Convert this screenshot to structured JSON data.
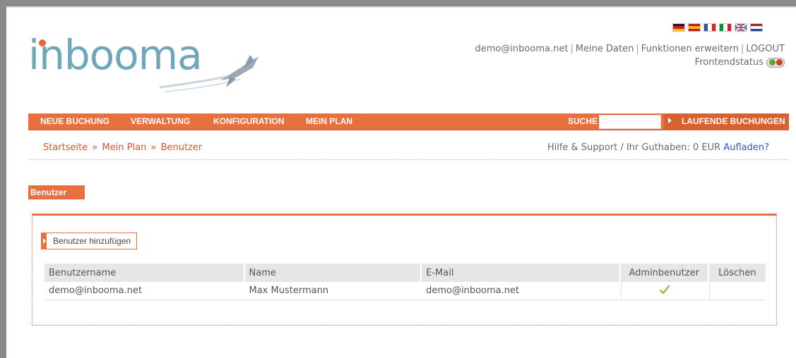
{
  "header": {
    "logo_text": "inbooma",
    "flags": [
      {
        "name": "german-flag-icon",
        "colors": [
          "#1a1a1a",
          "#d21f1f",
          "#f3c21a"
        ],
        "dir": "h"
      },
      {
        "name": "spanish-flag-icon",
        "colors": [
          "#c8102e",
          "#f6c300",
          "#c8102e"
        ],
        "dir": "h"
      },
      {
        "name": "french-flag-icon",
        "colors": [
          "#3552a0",
          "#ffffff",
          "#d52b1e"
        ],
        "dir": "v"
      },
      {
        "name": "italian-flag-icon",
        "colors": [
          "#0a8f3c",
          "#ffffff",
          "#d21f2b"
        ],
        "dir": "v"
      },
      {
        "name": "uk-flag-icon",
        "colors": [
          "#2b3f8a",
          "#ffffff",
          "#c8102e"
        ],
        "dir": "uk"
      },
      {
        "name": "dutch-flag-icon",
        "colors": [
          "#ae1c28",
          "#ffffff",
          "#21468b"
        ],
        "dir": "h"
      }
    ],
    "user_email": "demo@inbooma.net",
    "meine_daten": "Meine Daten",
    "funktionen": "Funktionen erweitern",
    "logout": "LOGOUT",
    "frontend_status": "Frontendstatus"
  },
  "nav": {
    "neue_buchung": "NEUE BUCHUNG",
    "verwaltung": "VERWALTUNG",
    "konfiguration": "KONFIGURATION",
    "mein_plan": "MEIN PLAN",
    "suche": "SUCHE",
    "search_value": "",
    "laufende": "LAUFENDE BUCHUNGEN"
  },
  "breadcrumb": {
    "startseite": "Startseite",
    "mein_plan": "Mein Plan",
    "benutzer": "Benutzer",
    "sep": "»"
  },
  "support": {
    "text": "Hilfe & Support / Ihr Guthaben: 0 EUR",
    "aufladen": "Aufladen?"
  },
  "section": {
    "title": "Benutzer",
    "add_button": "Benutzer hinzufügen"
  },
  "table": {
    "headers": [
      "Benutzername",
      "Name",
      "E-Mail",
      "Adminbenutzer",
      "Löschen"
    ],
    "rows": [
      {
        "username": "demo@inbooma.net",
        "name": "Max Mustermann",
        "email": "demo@inbooma.net",
        "admin": "checkmark-icon",
        "delete": ""
      }
    ]
  },
  "colors": {
    "accent": "#e8703f",
    "logo": "#6fa6ba",
    "link_blue": "#2a56b8"
  }
}
